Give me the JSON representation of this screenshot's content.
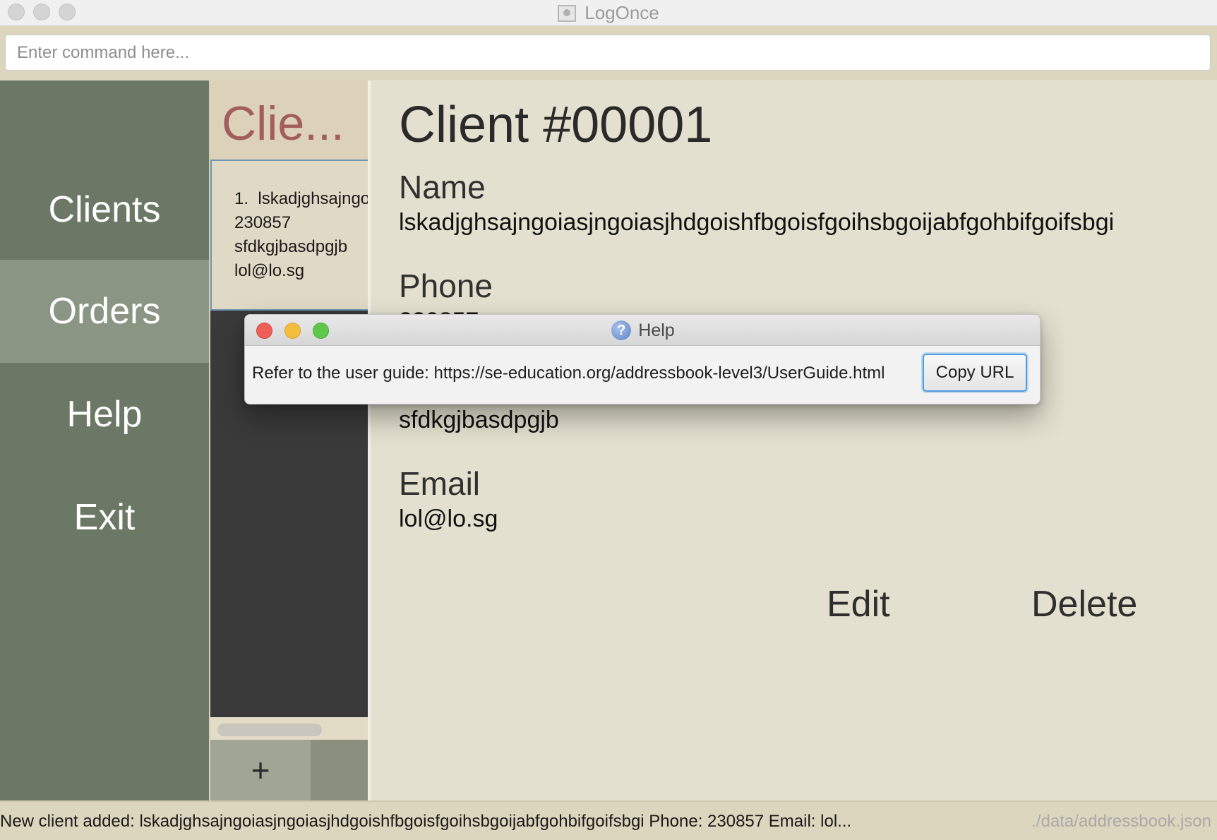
{
  "window": {
    "title": "LogOnce",
    "app_icon": "app-window-icon"
  },
  "command": {
    "placeholder": "Enter command here...",
    "value": ""
  },
  "sidebar": {
    "items": [
      {
        "label": "Clients",
        "active": false
      },
      {
        "label": "Orders",
        "active": true
      },
      {
        "label": "Help",
        "active": false
      },
      {
        "label": "Exit",
        "active": false
      }
    ]
  },
  "client_list": {
    "header": "Clie...",
    "cards": [
      {
        "index": "1.",
        "name": "lskadjghsajngoiasjngoiasjhdgoishfbgoisfgoihsbgoijabfgohbifgoifsbgi",
        "phone": "230857",
        "address": "sfdkgjbasdpgjb",
        "email": "lol@lo.sg"
      }
    ],
    "add_button": "+"
  },
  "detail": {
    "title": "Client #00001",
    "name_label": "Name",
    "name_value": "lskadjghsajngoiasjngoiasjhdgoishfbgoisfgoihsbgoijabfgohbifgoifsbgi",
    "phone_label": "Phone",
    "phone_value": "230857",
    "address_value": "sfdkgjbasdpgjb",
    "email_label": "Email",
    "email_value": "lol@lo.sg",
    "edit_label": "Edit",
    "delete_label": "Delete"
  },
  "status": {
    "message": "New client added: lskadjghsajngoiasjngoiasjhdgoishfbgoisfgoihsbgoijabfgohbifgoifsbgi Phone: 230857 Email: lol...",
    "file_path": "./data/addressbook.json"
  },
  "help_dialog": {
    "title": "Help",
    "icon": "question-mark-icon",
    "message": "Refer to the user guide: https://se-education.org/addressbook-level3/UserGuide.html",
    "copy_button": "Copy URL"
  },
  "colors": {
    "sidebar": "#6b7866",
    "sidebar_active": "#8a9683",
    "list_header_text": "#a35d5d",
    "detail_bg": "#e4e0cf",
    "focus_blue": "#4d9be0"
  }
}
